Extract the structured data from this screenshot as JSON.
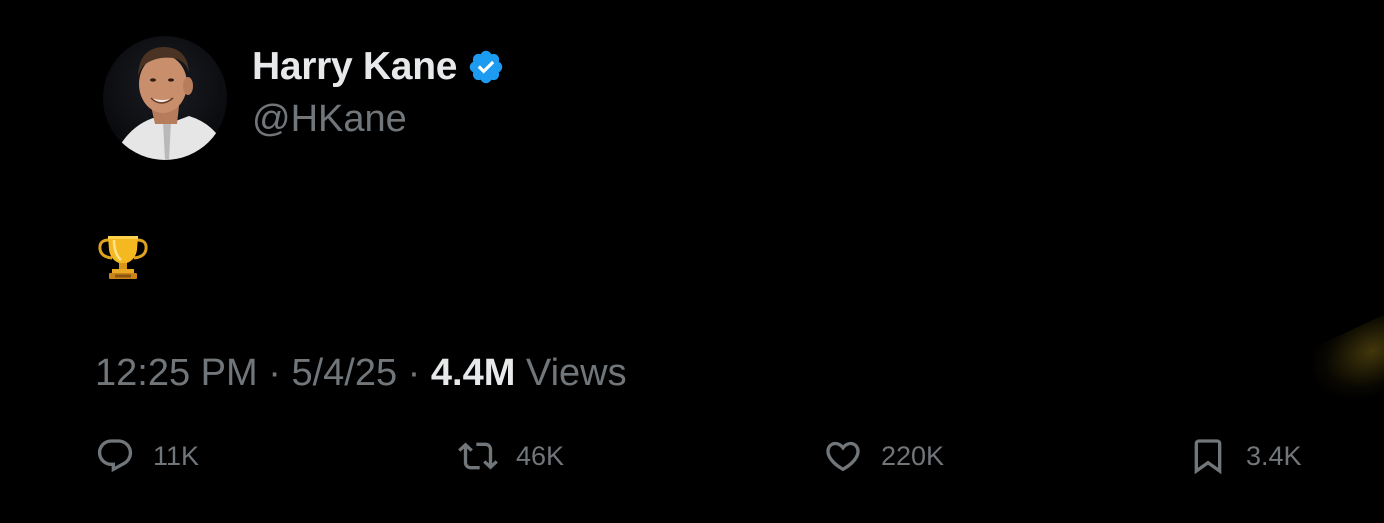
{
  "author": {
    "display_name": "Harry Kane",
    "handle": "@HKane",
    "verified": true,
    "avatar": "profile-photo",
    "verified_color": "#1d9bf0"
  },
  "tweet": {
    "text_emoji": "trophy-emoji"
  },
  "meta": {
    "time": "12:25 PM",
    "sep1": " · ",
    "date": "5/4/25",
    "sep2": " · ",
    "views_count": "4.4M",
    "views_label": " Views"
  },
  "actions": {
    "reply": {
      "icon": "reply-icon",
      "count": "11K"
    },
    "retweet": {
      "icon": "retweet-icon",
      "count": "46K"
    },
    "like": {
      "icon": "heart-icon",
      "count": "220K"
    },
    "bookmark": {
      "icon": "bookmark-icon",
      "count": "3.4K"
    }
  },
  "colors": {
    "background": "#000000",
    "primary_text": "#e7e9ea",
    "secondary_text": "#71767b"
  }
}
